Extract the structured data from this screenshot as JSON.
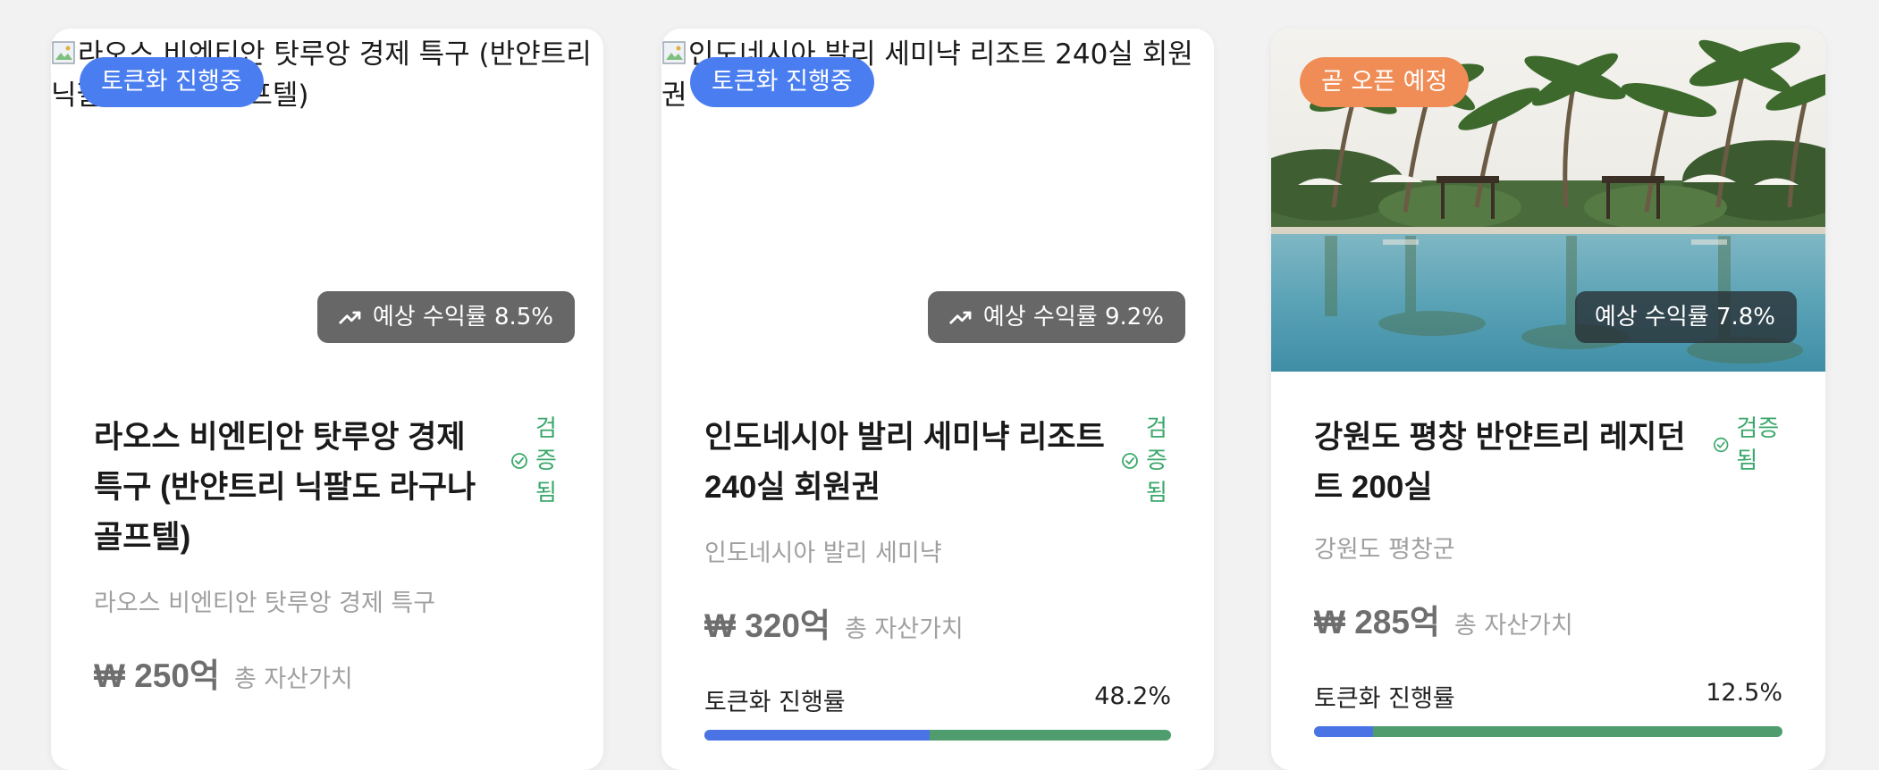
{
  "colors": {
    "tokenizing_badge": "#4a7ef0",
    "opening_badge": "#f08c55",
    "verified": "#3aa86b",
    "progress_fill": "#4a73e6",
    "progress_track": "#4f9d6e"
  },
  "cards": [
    {
      "image_alt": "라오스 비엔티안 탓루앙 경제 특구 (반얀트리 닉팔도 라구나 골프텔)",
      "status": "토큰화 진행중",
      "yield": "예상 수익률 8.5%",
      "title": "라오스 비엔티안 탓루앙 경제 특구 (반얀트리 닉팔도 라구나 골프텔)",
      "verified": "검증됨",
      "location": "라오스 비엔티안 탓루앙 경제 특구",
      "price": "₩ 250억",
      "price_label": "총 자산가치",
      "progress_label": "",
      "progress_value": ""
    },
    {
      "image_alt": "인도네시아 발리 세미냑 리조트 240실 회원권",
      "status": "토큰화 진행중",
      "yield": "예상 수익률 9.2%",
      "title": "인도네시아 발리 세미냑 리조트 240실 회원권",
      "verified": "검증됨",
      "location": "인도네시아 발리 세미냑",
      "price": "₩ 320억",
      "price_label": "총 자산가치",
      "progress_label": "토큰화 진행률",
      "progress_value": "48.2%",
      "progress_fraction": 0.482
    },
    {
      "image_alt": "",
      "status": "곧 오픈 예정",
      "yield": "예상 수익률 7.8%",
      "title": "강원도 평창 반얀트리 레지던트 200실",
      "verified": "검증됨",
      "location": "강원도 평창군",
      "price": "₩ 285억",
      "price_label": "총 자산가치",
      "progress_label": "토큰화 진행률",
      "progress_value": "12.5%",
      "progress_fraction": 0.125
    }
  ],
  "icons": {
    "trend": "trending-up-icon",
    "check": "check-circle-icon",
    "broken_image": "broken-image-icon"
  }
}
